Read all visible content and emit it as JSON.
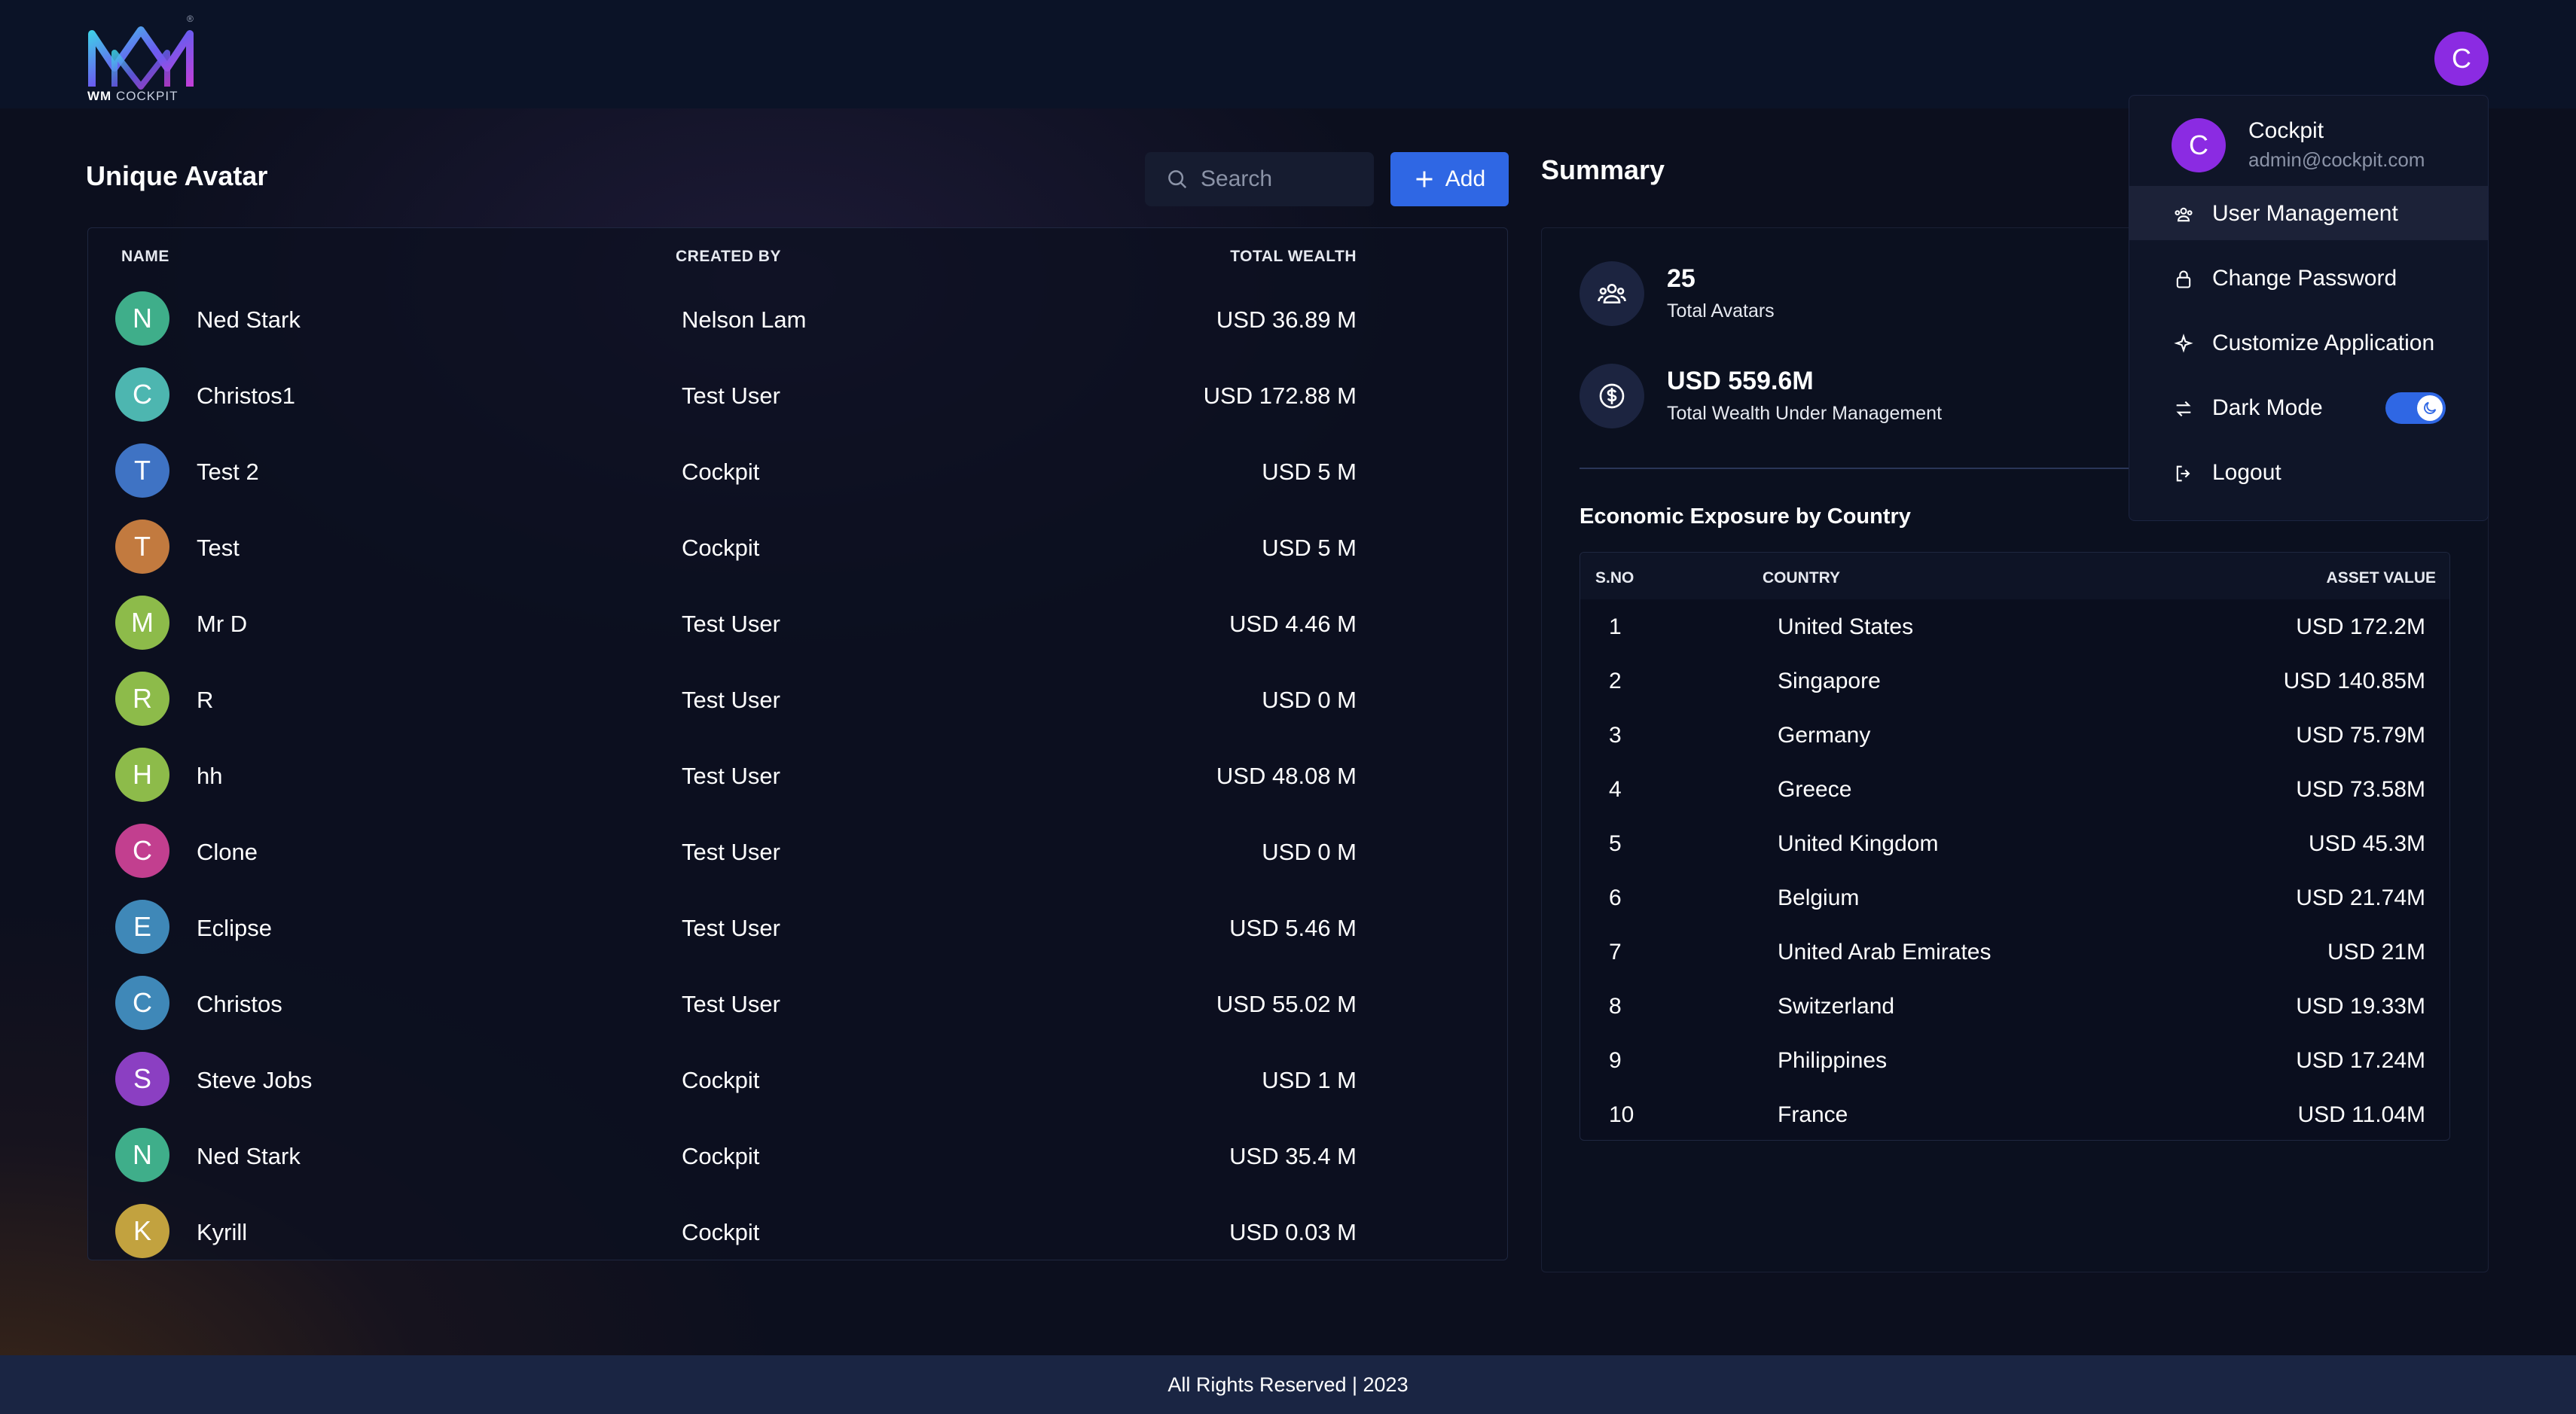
{
  "brand": {
    "logo_text_bold": "WM",
    "logo_text_rest": " COCKPIT",
    "registered": "®"
  },
  "user": {
    "initial": "C",
    "name": "Cockpit",
    "email": "admin@cockpit.com"
  },
  "left": {
    "title": "Unique Avatar",
    "search_placeholder": "Search",
    "add_label": "Add",
    "columns": {
      "name": "NAME",
      "created_by": "CREATED BY",
      "total_wealth": "TOTAL WEALTH"
    },
    "rows": [
      {
        "initial": "N",
        "color": "#3fae8a",
        "name": "Ned Stark",
        "created_by": "Nelson Lam",
        "wealth": "USD 36.89 M"
      },
      {
        "initial": "C",
        "color": "#4db6b0",
        "name": "Christos1",
        "created_by": "Test User",
        "wealth": "USD 172.88 M"
      },
      {
        "initial": "T",
        "color": "#3f73c4",
        "name": "Test 2",
        "created_by": "Cockpit",
        "wealth": "USD 5 M"
      },
      {
        "initial": "T",
        "color": "#c27a3f",
        "name": "Test",
        "created_by": "Cockpit",
        "wealth": "USD 5 M"
      },
      {
        "initial": "M",
        "color": "#8dbb4a",
        "name": "Mr D",
        "created_by": "Test User",
        "wealth": "USD 4.46 M"
      },
      {
        "initial": "R",
        "color": "#8dbb4a",
        "name": "R",
        "created_by": "Test User",
        "wealth": "USD 0 M"
      },
      {
        "initial": "H",
        "color": "#8dbb4a",
        "name": "hh",
        "created_by": "Test User",
        "wealth": "USD 48.08 M"
      },
      {
        "initial": "C",
        "color": "#c23f8f",
        "name": "Clone",
        "created_by": "Test User",
        "wealth": "USD 0 M"
      },
      {
        "initial": "E",
        "color": "#3f88b8",
        "name": "Eclipse",
        "created_by": "Test User",
        "wealth": "USD 5.46 M"
      },
      {
        "initial": "C",
        "color": "#3f88b8",
        "name": "Christos",
        "created_by": "Test User",
        "wealth": "USD 55.02 M"
      },
      {
        "initial": "S",
        "color": "#8b3fc2",
        "name": "Steve Jobs",
        "created_by": "Cockpit",
        "wealth": "USD 1 M"
      },
      {
        "initial": "N",
        "color": "#3fae8a",
        "name": "Ned Stark",
        "created_by": "Cockpit",
        "wealth": "USD 35.4 M"
      },
      {
        "initial": "K",
        "color": "#c2a23f",
        "name": "Kyrill",
        "created_by": "Cockpit",
        "wealth": "USD 0.03 M"
      }
    ]
  },
  "summary": {
    "title": "Summary",
    "total_avatars_value": "25",
    "total_avatars_label": "Total Avatars",
    "total_wealth_value": "USD 559.6M",
    "total_wealth_label": "Total Wealth Under Management",
    "exposure_title": "Economic Exposure by Country",
    "exposure_columns": {
      "sno": "S.NO",
      "country": "COUNTRY",
      "asset_value": "ASSET VALUE"
    },
    "exposure_rows": [
      {
        "sno": "1",
        "country": "United States",
        "value": "USD 172.2M"
      },
      {
        "sno": "2",
        "country": "Singapore",
        "value": "USD 140.85M"
      },
      {
        "sno": "3",
        "country": "Germany",
        "value": "USD 75.79M"
      },
      {
        "sno": "4",
        "country": "Greece",
        "value": "USD 73.58M"
      },
      {
        "sno": "5",
        "country": "United Kingdom",
        "value": "USD 45.3M"
      },
      {
        "sno": "6",
        "country": "Belgium",
        "value": "USD 21.74M"
      },
      {
        "sno": "7",
        "country": "United Arab Emirates",
        "value": "USD 21M"
      },
      {
        "sno": "8",
        "country": "Switzerland",
        "value": "USD 19.33M"
      },
      {
        "sno": "9",
        "country": "Philippines",
        "value": "USD 17.24M"
      },
      {
        "sno": "10",
        "country": "France",
        "value": "USD 11.04M"
      }
    ]
  },
  "menu": {
    "items": [
      {
        "label": "User Management",
        "icon": "users-icon"
      },
      {
        "label": "Change Password",
        "icon": "lock-icon"
      },
      {
        "label": "Customize Application",
        "icon": "sparkle-icon"
      },
      {
        "label": "Dark Mode",
        "icon": "swap-icon",
        "toggle_on": true
      },
      {
        "label": "Logout",
        "icon": "logout-icon"
      }
    ]
  },
  "footer": {
    "text": "All Rights Reserved | 2023"
  },
  "colors": {
    "accent": "#2f67e4",
    "user_avatar": "#8b2be2",
    "background": "#0c0f1e"
  }
}
